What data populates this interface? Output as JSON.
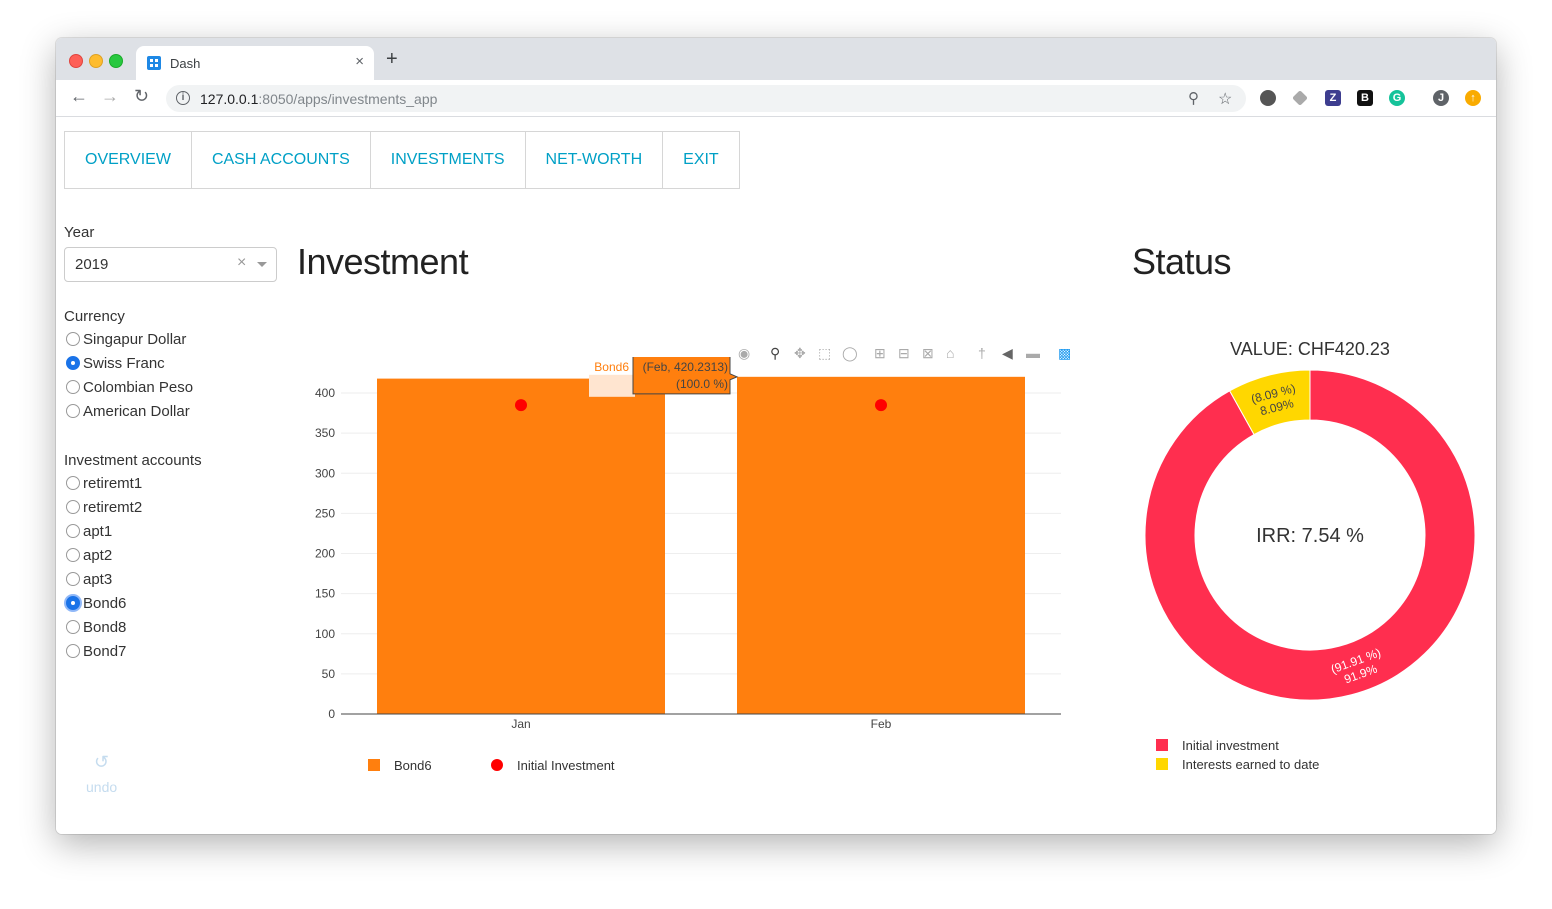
{
  "browser": {
    "tab_title": "Dash",
    "tab_close": "×",
    "new_tab": "+",
    "url_host": "127.0.0.1",
    "url_path": ":8050/apps/investments_app"
  },
  "navbar": [
    "OVERVIEW",
    "CASH ACCOUNTS",
    "INVESTMENTS",
    "NET-WORTH",
    "EXIT"
  ],
  "sidebar": {
    "year_label": "Year",
    "year_value": "2019",
    "clear_symbol": "×",
    "currency_label": "Currency",
    "currencies": [
      {
        "label": "Singapur Dollar",
        "checked": false
      },
      {
        "label": "Swiss Franc",
        "checked": true
      },
      {
        "label": "Colombian Peso",
        "checked": false
      },
      {
        "label": "American Dollar",
        "checked": false
      }
    ],
    "accounts_label": "Investment accounts",
    "accounts": [
      {
        "label": "retiremt1",
        "checked": false
      },
      {
        "label": "retiremt2",
        "checked": false
      },
      {
        "label": "apt1",
        "checked": false
      },
      {
        "label": "apt2",
        "checked": false
      },
      {
        "label": "apt3",
        "checked": false
      },
      {
        "label": "Bond6",
        "checked": true
      },
      {
        "label": "Bond8",
        "checked": false
      },
      {
        "label": "Bond7",
        "checked": false
      }
    ],
    "undo_label": "undo"
  },
  "investment": {
    "title": "Investment"
  },
  "status": {
    "title": "Status"
  },
  "chart_data": [
    {
      "type": "bar",
      "categories": [
        "Jan",
        "Feb"
      ],
      "series": [
        {
          "name": "Bond6",
          "kind": "bar",
          "color": "#ff7f0e",
          "values": [
            418,
            420.2313
          ]
        },
        {
          "name": "Initial Investment",
          "kind": "marker",
          "color": "#ff0000",
          "values": [
            385,
            385
          ]
        }
      ],
      "ylim": [
        0,
        420
      ],
      "yticks": [
        0,
        50,
        100,
        150,
        200,
        250,
        300,
        350,
        400
      ],
      "grid": true,
      "legend": "bottom",
      "hover": {
        "series": "Bond6",
        "line1": "(Feb, 420.2313)",
        "line2": "(100.0 %)"
      }
    },
    {
      "type": "pie",
      "title": "VALUE: CHF420.23",
      "center_label": "IRR: 7.54 %",
      "slices": [
        {
          "name": "Initial investment",
          "value": 91.91,
          "label_line1": "(91.91 %)",
          "label_line2": "91.9%",
          "color": "#ff2e4f"
        },
        {
          "name": "Interests earned to date",
          "value": 8.09,
          "label_line1": "(8.09 %)",
          "label_line2": "8.09%",
          "color": "#ffd700"
        }
      ],
      "legend": "bottom-left"
    }
  ]
}
